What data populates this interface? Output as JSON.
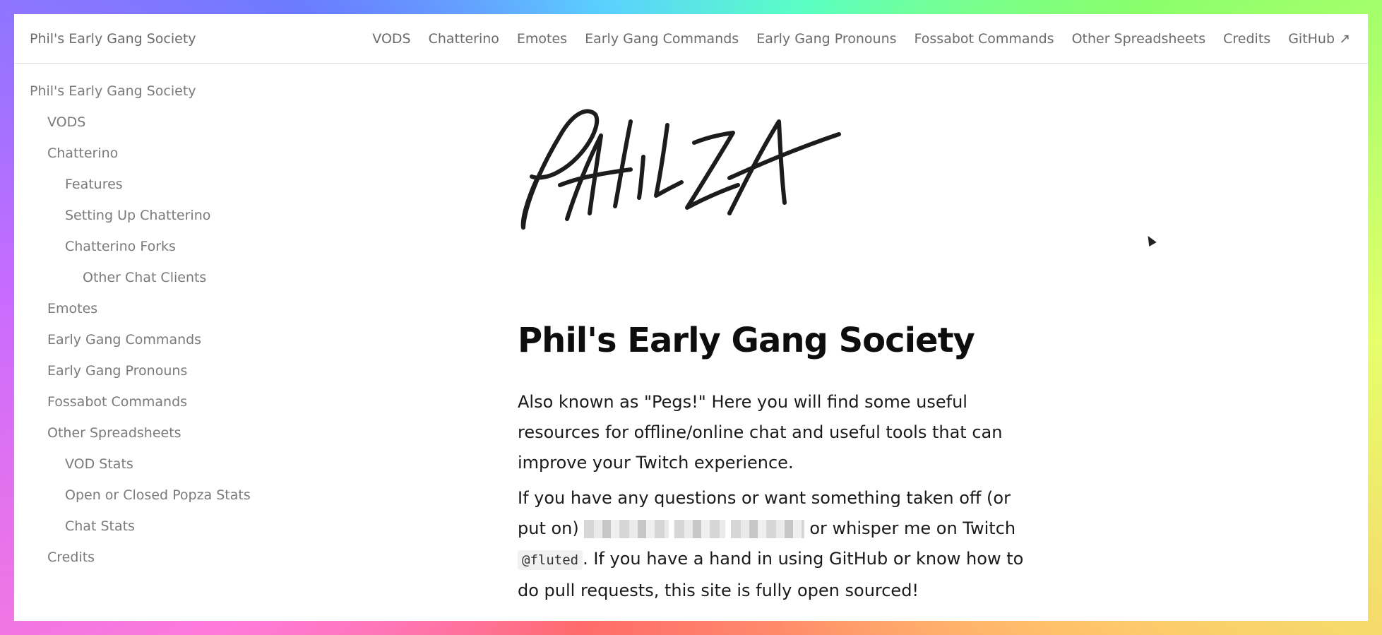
{
  "header": {
    "site_title": "Phil's Early Gang Society",
    "nav": [
      "VODS",
      "Chatterino",
      "Emotes",
      "Early Gang Commands",
      "Early Gang Pronouns",
      "Fossabot Commands",
      "Other Spreadsheets",
      "Credits",
      "GitHub ↗"
    ]
  },
  "sidebar": {
    "items": [
      {
        "label": "Phil's Early Gang Society",
        "level": 0
      },
      {
        "label": "VODS",
        "level": 1
      },
      {
        "label": "Chatterino",
        "level": 1
      },
      {
        "label": "Features",
        "level": 2
      },
      {
        "label": "Setting Up Chatterino",
        "level": 2
      },
      {
        "label": "Chatterino Forks",
        "level": 2
      },
      {
        "label": "Other Chat Clients",
        "level": 3
      },
      {
        "label": "Emotes",
        "level": 1
      },
      {
        "label": "Early Gang Commands",
        "level": 1
      },
      {
        "label": "Early Gang Pronouns",
        "level": 1
      },
      {
        "label": "Fossabot Commands",
        "level": 1
      },
      {
        "label": "Other Spreadsheets",
        "level": 1
      },
      {
        "label": "VOD Stats",
        "level": 2
      },
      {
        "label": "Open or Closed Popza Stats",
        "level": 2
      },
      {
        "label": "Chat Stats",
        "level": 2
      },
      {
        "label": "Credits",
        "level": 1
      }
    ]
  },
  "main": {
    "logo_text": "PHILZA",
    "title": "Phil's Early Gang Society",
    "intro": "Also known as \"Pegs!\" Here you will find some useful resources for offline/online chat and useful tools that can improve your Twitch experience.",
    "contact_prefix": "If you have any questions or want something taken off (or put on)",
    "contact_middle": "or whisper me on Twitch",
    "twitch_handle": "@fluted",
    "contact_suffix": ". If you have a hand in using GitHub or know how to do pull requests, this site is fully open sourced!"
  }
}
